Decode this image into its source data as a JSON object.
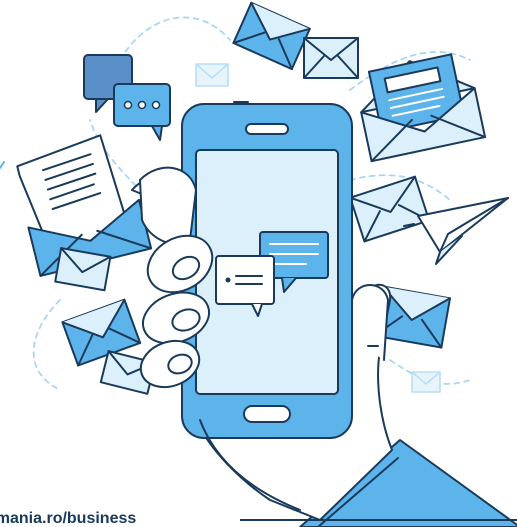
{
  "illustration": {
    "subject": "hand-holding-smartphone-with-messages",
    "colors": {
      "outline": "#1a3a5c",
      "primary": "#5cb4ea",
      "light": "#dcf0fc",
      "paper": "#ffffff",
      "dashed": "#a9d7f3"
    }
  },
  "footer": {
    "url_text": "omania.ro/business"
  }
}
